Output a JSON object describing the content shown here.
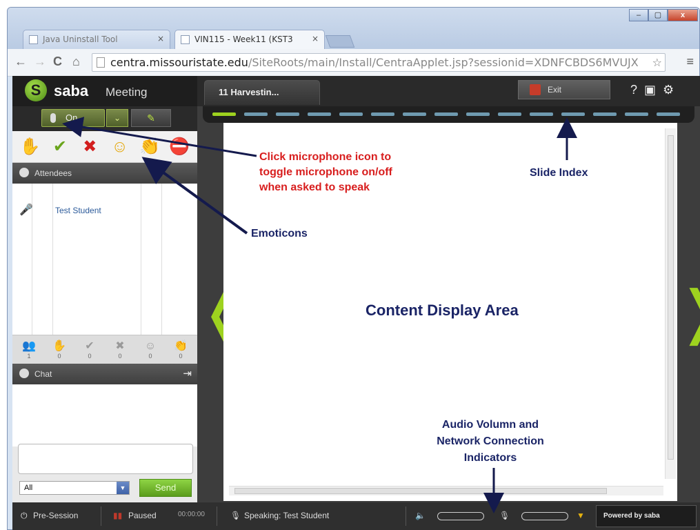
{
  "browser": {
    "tabs": [
      {
        "label": "Java Uninstall Tool",
        "close": "×",
        "active": false
      },
      {
        "label": "VIN115 - Week11 (KST3",
        "close": "×",
        "active": true
      }
    ],
    "window_controls": [
      "–",
      "▢",
      "x"
    ],
    "nav": {
      "back": "←",
      "forward": "→",
      "reload": "C",
      "home": "⌂"
    },
    "url": {
      "domain": "centra.missouristate.edu",
      "path": "/SiteRoots/main/Install/CentraApplet.jsp?sessionid=XDNFCBDS6MVUJX"
    },
    "star": "☆",
    "menu": "≡"
  },
  "app": {
    "logo": {
      "brand": "saba",
      "product": "Meeting",
      "mark": "S"
    },
    "mic": {
      "label": "On",
      "dropdown": "⌄",
      "pen": "✎"
    },
    "emoticons": [
      "✋",
      "✔",
      "✖",
      "☺",
      "👏",
      "⛔"
    ],
    "attendees": {
      "header": "Attendees",
      "rows": [
        {
          "name": "Test Student",
          "status_icon": "🎤"
        }
      ]
    },
    "status_counts": [
      {
        "icon": "👥",
        "count": "1"
      },
      {
        "icon": "✋",
        "count": "0"
      },
      {
        "icon": "✔",
        "count": "0"
      },
      {
        "icon": "✖",
        "count": "0"
      },
      {
        "icon": "☺",
        "count": "0"
      },
      {
        "icon": "👏",
        "count": "0"
      }
    ],
    "chat": {
      "header": "Chat",
      "export": "⇥",
      "recipient": "All",
      "send_label": "Send",
      "input_value": ""
    },
    "top": {
      "session_title": "11 Harvestin...",
      "exit_label": "Exit",
      "icons": [
        "?",
        "▣",
        "⚙"
      ]
    },
    "slide_index": {
      "total": 15,
      "current": 1
    },
    "nav_arrows": {
      "prev": "❬",
      "next": "❭"
    },
    "statusbar": {
      "pre_session": "Pre-Session",
      "paused": "Paused",
      "timer": "00:00:00",
      "speaking": "Speaking: Test Student",
      "powered_by": "Powered by saba"
    }
  },
  "annotations": {
    "mic_note": [
      "Click microphone icon to",
      "toggle microphone on/off",
      "when asked to speak"
    ],
    "emoticons": "Emoticons",
    "slide_index": "Slide Index",
    "content_area": "Content Display Area",
    "audio_note": [
      "Audio Volumn and",
      "Network Connection",
      "Indicators"
    ]
  },
  "colors": {
    "accent_green": "#9ed21f",
    "annotation_red": "#d81e1e",
    "annotation_navy": "#1a2466"
  }
}
